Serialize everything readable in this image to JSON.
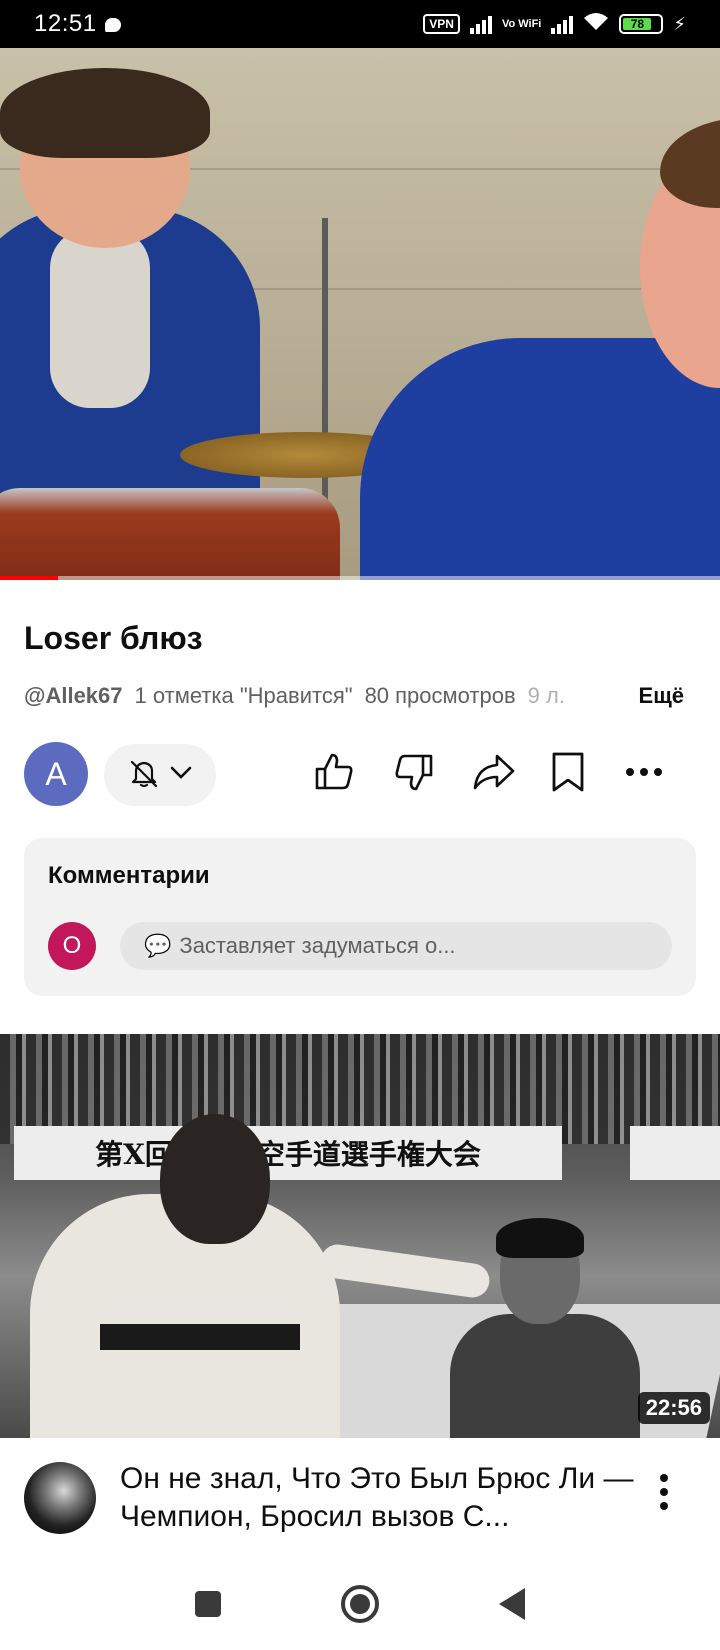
{
  "status_bar": {
    "time": "12:51",
    "vpn_label": "VPN",
    "vowifi_label": "Vo WiFi",
    "battery_level": "78",
    "icons": [
      "chat-bubble-icon",
      "signal-icon",
      "wifi-icon",
      "battery-icon",
      "charging-bolt-icon"
    ]
  },
  "player": {
    "progress_fraction": 0.08,
    "accent_color": "#ff0000"
  },
  "video": {
    "title": "Loser блюз",
    "channel_handle": "@Allek67",
    "likes_text": "1 отметка \"Нравится\"",
    "views_text": "80 просмотров",
    "age_text": "9 л.",
    "more_label": "Ещё"
  },
  "actions": {
    "channel_avatar_letter": "A",
    "channel_avatar_color": "#5c6bc0",
    "icons": [
      "bell-off-icon",
      "chevron-down-icon",
      "thumbs-up-icon",
      "thumbs-down-icon",
      "share-icon",
      "bookmark-icon",
      "more-horizontal-icon"
    ]
  },
  "comments": {
    "heading": "Комментарии",
    "avatar_letter": "O",
    "avatar_color": "#c2185b",
    "preview_emoji": "💬",
    "preview_text": "Заставляет задуматься о..."
  },
  "next_video": {
    "banner_text": "第X回全日本空手道選手権大会",
    "duration": "22:56",
    "title": "Он не знал, Что Это Был Брюс Ли — Чемпион, Бросил вызов С..."
  },
  "nav_bar": {
    "icons": [
      "recents-square-icon",
      "home-circle-icon",
      "back-triangle-icon"
    ]
  }
}
